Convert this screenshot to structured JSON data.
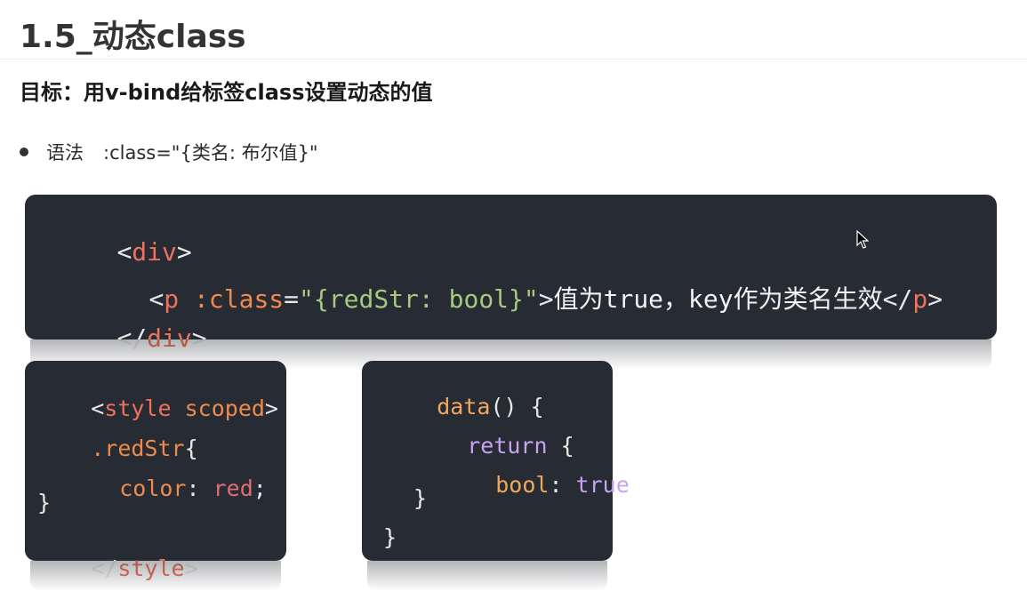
{
  "heading": "1.5_动态class",
  "goal": "目标：用v-bind给标签class设置动态的值",
  "bullet": {
    "label": "语法",
    "syntax": ":class=\"{类名: 布尔值}\""
  },
  "template_code": {
    "l1": {
      "open": "<",
      "tag": "div",
      "close": ">"
    },
    "l2": {
      "open": "<",
      "tag": "p",
      "space": " ",
      "attr": ":class",
      "eq": "=",
      "value": "\"{redStr: bool}\"",
      "gt": ">",
      "text": "值为true，key作为类名生效",
      "close_open": "</",
      "close_tag": "p",
      "close_gt": ">"
    },
    "l3": {
      "open": "</",
      "tag": "div",
      "close": ">"
    }
  },
  "style_code": {
    "l1": {
      "open": "<",
      "tag": "style",
      "sp": " ",
      "attr": "scoped",
      "close": ">"
    },
    "l2": {
      "selector": ".redStr",
      "brace": "{"
    },
    "l3": {
      "prop": "color",
      "colon": ": ",
      "value": "red",
      "semi": ";"
    },
    "l4": "}",
    "l5": {
      "open": "</",
      "tag": "style",
      "close": ">"
    }
  },
  "data_code": {
    "l1": {
      "fn": "data",
      "rest": "() {"
    },
    "l2": {
      "kw": "return",
      "rest": " {"
    },
    "l3": {
      "key": "bool",
      "colon": ": ",
      "value": "true"
    },
    "l4": "}",
    "l5": "}"
  }
}
